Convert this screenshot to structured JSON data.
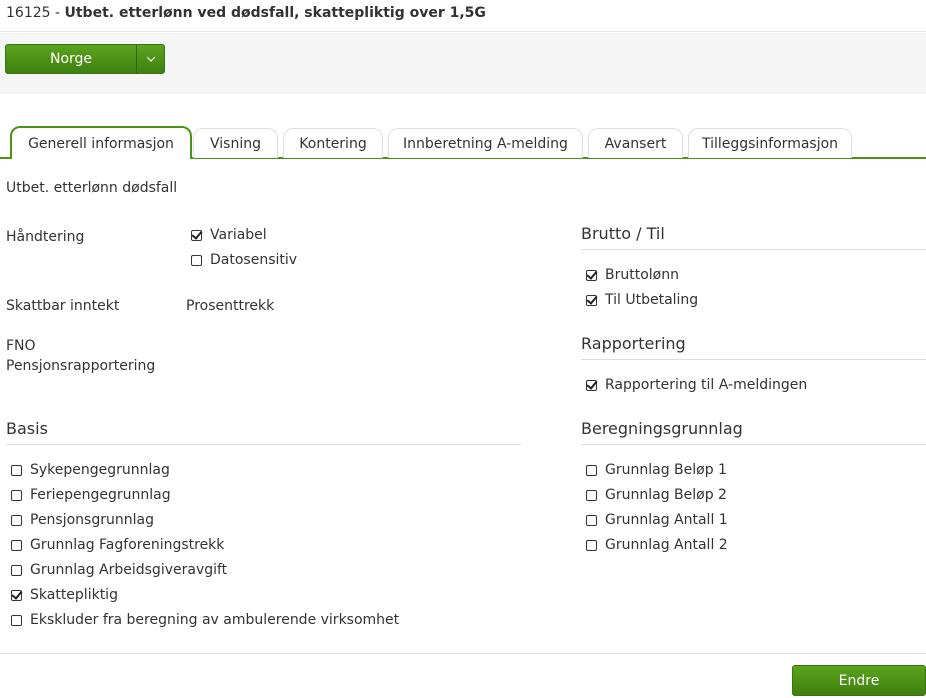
{
  "header": {
    "code": "16125",
    "separator": " - ",
    "title": "Utbet. etterlønn ved dødsfall, skattepliktig over 1,5G"
  },
  "toolbar": {
    "country_label": "Norge",
    "dropdown_icon": "chevron-down-icon"
  },
  "tabs": [
    {
      "label": "Generell informasjon",
      "active": true
    },
    {
      "label": "Visning",
      "active": false
    },
    {
      "label": "Kontering",
      "active": false
    },
    {
      "label": "Innberetning A-melding",
      "active": false
    },
    {
      "label": "Avansert",
      "active": false
    },
    {
      "label": "Tilleggsinformasjon",
      "active": false
    }
  ],
  "general": {
    "description": "Utbet. etterlønn dødsfall",
    "handling_label": "Håndtering",
    "handling_options": [
      {
        "label": "Variabel",
        "checked": true
      },
      {
        "label": "Datosensitiv",
        "checked": false
      }
    ],
    "taxable_label": "Skattbar inntekt",
    "taxable_value": "Prosenttrekk",
    "fno_label": "FNO",
    "pension_label": "Pensjonsrapportering"
  },
  "basis": {
    "heading": "Basis",
    "items": [
      {
        "label": "Sykepengegrunnlag",
        "checked": false
      },
      {
        "label": "Feriepengegrunnlag",
        "checked": false
      },
      {
        "label": "Pensjonsgrunnlag",
        "checked": false
      },
      {
        "label": "Grunnlag Fagforeningstrekk",
        "checked": false
      },
      {
        "label": "Grunnlag Arbeidsgiveravgift",
        "checked": false
      },
      {
        "label": "Skattepliktig",
        "checked": true
      },
      {
        "label": "Ekskluder fra beregning av ambulerende virksomhet",
        "checked": false
      }
    ]
  },
  "gross": {
    "heading": "Brutto / Til",
    "items": [
      {
        "label": "Bruttolønn",
        "checked": true
      },
      {
        "label": "Til Utbetaling",
        "checked": true
      }
    ]
  },
  "reporting": {
    "heading": "Rapportering",
    "items": [
      {
        "label": "Rapportering til A-meldingen",
        "checked": true
      }
    ]
  },
  "calc_basis": {
    "heading": "Beregningsgrunnlag",
    "items": [
      {
        "label": "Grunnlag Beløp 1",
        "checked": false
      },
      {
        "label": "Grunnlag Beløp 2",
        "checked": false
      },
      {
        "label": "Grunnlag Antall 1",
        "checked": false
      },
      {
        "label": "Grunnlag Antall 2",
        "checked": false
      }
    ]
  },
  "footer": {
    "edit_label": "Endre"
  },
  "colors": {
    "accent": "#4a9415",
    "button_green": "#4e941a"
  }
}
